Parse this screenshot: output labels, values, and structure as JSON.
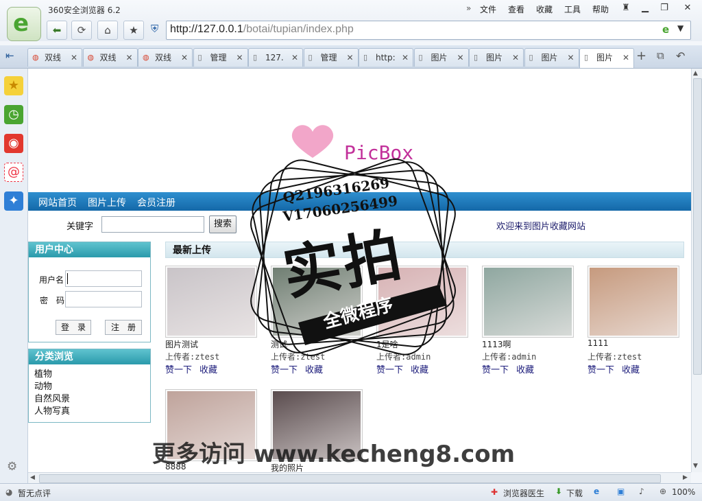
{
  "browser": {
    "title": "360安全浏览器 6.2",
    "menu": [
      "文件",
      "查看",
      "收藏",
      "工具",
      "帮助"
    ],
    "address_host": "http://127.0.0.1",
    "address_path": "/botai/tupian/index.php",
    "tabs": [
      {
        "label": "双线",
        "type": "globe"
      },
      {
        "label": "双线",
        "type": "globe"
      },
      {
        "label": "双线",
        "type": "globe"
      },
      {
        "label": "管理",
        "type": "page"
      },
      {
        "label": "127.",
        "type": "page"
      },
      {
        "label": "管理",
        "type": "page"
      },
      {
        "label": "http:",
        "type": "page"
      },
      {
        "label": "图片",
        "type": "page"
      },
      {
        "label": "图片",
        "type": "page"
      },
      {
        "label": "图片",
        "type": "page"
      },
      {
        "label": "图片",
        "type": "page"
      }
    ],
    "status_left": "暂无点评",
    "status_doctor": "浏览器医生",
    "status_download": "下载",
    "zoom": "100%"
  },
  "site": {
    "logo_text": "PicBox",
    "nav": [
      "网站首页",
      "图片上传",
      "会员注册"
    ],
    "search_label": "关键字",
    "search_button": "搜索",
    "welcome": "欢迎来到图片收藏网站",
    "user_center_title": "用户中心",
    "username_label": "用户名",
    "password_label": "密　码",
    "login_button": "登　录",
    "register_button": "注　册",
    "category_title": "分类浏览",
    "categories": [
      "植物",
      "动物",
      "自然风景",
      "人物写真"
    ],
    "latest_title": "最新上传",
    "uploader_prefix": "上传者:",
    "like_label": "赞一下",
    "collect_label": "收藏",
    "photos": [
      {
        "title": "图片测试",
        "uploader": "ztest",
        "color": "#c9c4c8"
      },
      {
        "title": "测试",
        "uploader": "ztest",
        "color": "#6f7e72"
      },
      {
        "title": "1是啥",
        "uploader": "admin",
        "color": "#d7b2b4"
      },
      {
        "title": "1113啊",
        "uploader": "admin",
        "color": "#8fa7a0"
      },
      {
        "title": "1111",
        "uploader": "ztest",
        "color": "#c69a7e"
      },
      {
        "title": "8888",
        "uploader": "",
        "color": "#bfa39b"
      },
      {
        "title": "我的照片",
        "uploader": "",
        "color": "#5a4c4e"
      }
    ]
  },
  "watermark": {
    "qq": "Q2196316269",
    "vx": "V17060256499",
    "big": "实拍",
    "ribbon": "全微程序",
    "footer": "更多访问 www.kecheng8.com"
  }
}
